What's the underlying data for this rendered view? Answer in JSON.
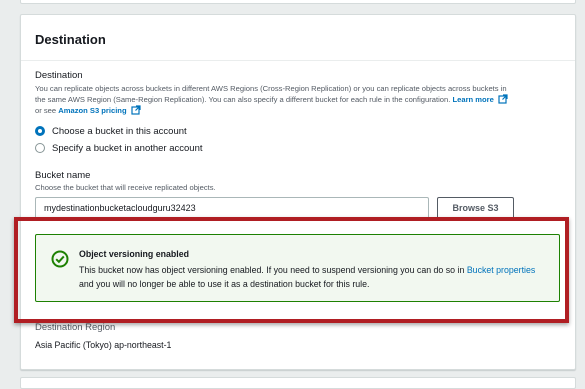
{
  "section": {
    "title": "Destination",
    "destination_label": "Destination",
    "destination_description_1": "You can replicate objects across buckets in different AWS Regions (Cross-Region Replication) or you can replicate objects across buckets in",
    "destination_description_2": "the same AWS Region (Same-Region Replication). You can also specify a different bucket for each rule in the configuration.",
    "learn_more_label": "Learn more",
    "or_see_text": "or see",
    "pricing_link_label": "Amazon S3 pricing",
    "radio_options": [
      {
        "label": "Choose a bucket in this account",
        "selected": true
      },
      {
        "label": "Specify a bucket in another account",
        "selected": false
      }
    ],
    "bucket_name_label": "Bucket name",
    "bucket_name_hint": "Choose the bucket that will receive replicated objects.",
    "bucket_name_value": "mydestinationbucketacloudguru32423",
    "browse_button_label": "Browse S3",
    "alert": {
      "title": "Object versioning enabled",
      "body_prefix": "This bucket now has object versioning enabled. If you need to suspend versioning you can do so in",
      "link_label": "Bucket properties",
      "body_suffix": "and you will no longer be able to use it as a destination bucket for this rule.",
      "icon": "check-circle-icon",
      "color": "#1d8102"
    },
    "destination_region_label": "Destination Region",
    "destination_region_value": "Asia Pacific (Tokyo) ap-northeast-1"
  },
  "colors": {
    "link": "#0073bb",
    "highlight_border": "#b01e23",
    "success": "#1d8102"
  }
}
